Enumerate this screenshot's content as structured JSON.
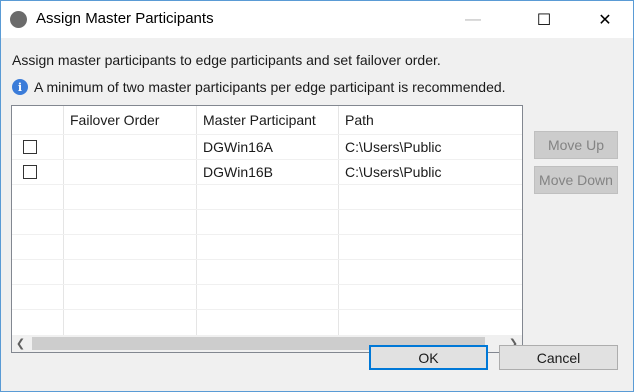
{
  "window": {
    "title": "Assign Master Participants",
    "controls": {
      "minimize": "—",
      "maximize": "☐",
      "close": "✕"
    }
  },
  "description": "Assign master participants to edge participants and set failover order.",
  "info": {
    "icon": "info-icon",
    "text": "A minimum of two master participants per edge participant is recommended."
  },
  "table": {
    "columns": [
      "",
      "Failover Order",
      "Master Participant",
      "Path"
    ],
    "rows": [
      {
        "checked": false,
        "failover_order": "",
        "master_participant": "DGWin16A",
        "path": "C:\\Users\\Public"
      },
      {
        "checked": false,
        "failover_order": "",
        "master_participant": "DGWin16B",
        "path": "C:\\Users\\Public"
      }
    ]
  },
  "side_buttons": {
    "move_up": "Move Up",
    "move_down": "Move Down"
  },
  "footer": {
    "ok": "OK",
    "cancel": "Cancel"
  },
  "colors": {
    "info_icon": "#3b7cd9",
    "default_button_border": "#0078d7",
    "disabled_button_bg": "#cccccc"
  }
}
